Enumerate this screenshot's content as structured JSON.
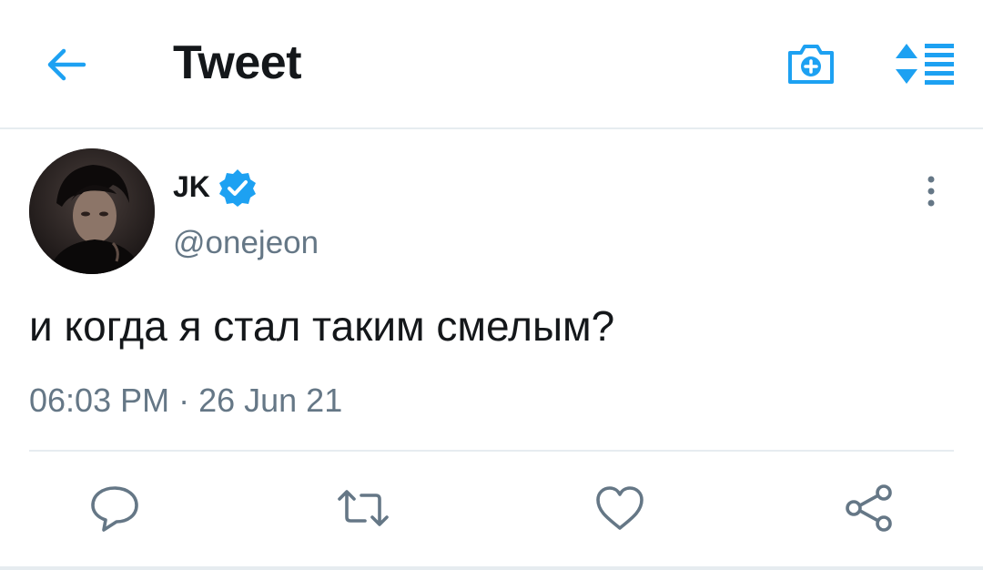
{
  "header": {
    "title": "Tweet",
    "icons": {
      "back": "arrow-left-icon",
      "camera": "camera-plus-icon",
      "sort": "sort-list-icon"
    }
  },
  "tweet": {
    "author": {
      "name": "JK",
      "handle": "@onejeon",
      "verified": true
    },
    "text": "и когда я стал таким смелым?",
    "timestamp": "06:03 PM · 26 Jun 21"
  },
  "actions": {
    "icons": [
      "reply-icon",
      "retweet-icon",
      "like-icon",
      "share-icon"
    ]
  },
  "colors": {
    "accent": "#1da1f2",
    "text_primary": "#14171a",
    "text_secondary": "#657786",
    "divider": "#e6ecf0"
  }
}
